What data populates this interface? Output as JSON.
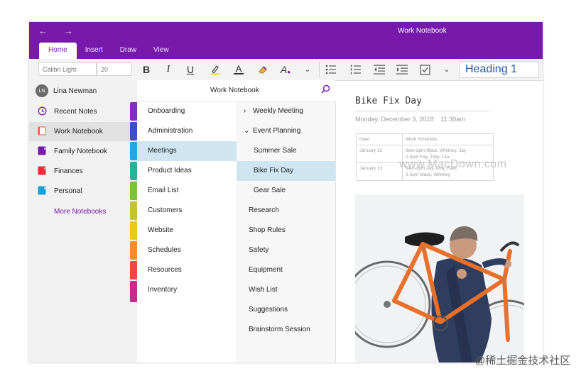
{
  "window": {
    "title": "Work Notebook",
    "back_icon": "back-arrow-icon",
    "forward_icon": "forward-arrow-icon"
  },
  "ribbon_tabs": [
    "Home",
    "Insert",
    "Draw",
    "View"
  ],
  "ribbon": {
    "font_name": "Calibri Light",
    "font_size": "20",
    "bold": "B",
    "italic": "I",
    "underline": "U",
    "font_color_glyph": "A",
    "text_style_glyph": "A",
    "style": "Heading 1"
  },
  "user": {
    "initials": "LN",
    "name": "Lina Newman"
  },
  "notebooks": [
    {
      "label": "Recent Notes",
      "icon": "clock-icon",
      "color": "#7719aa"
    },
    {
      "label": "Work Notebook",
      "icon": "notebook-icon",
      "color": "#e8603c"
    },
    {
      "label": "Family Notebook",
      "icon": "notebook-icon",
      "color": "#7719aa"
    },
    {
      "label": "Finances",
      "icon": "notebook-icon",
      "color": "#e0303b"
    },
    {
      "label": "Personal",
      "icon": "notebook-icon",
      "color": "#1aa0d8"
    }
  ],
  "more_notebooks": "More Notebooks",
  "notebook_pane_title": "Work Notebook",
  "sections": [
    {
      "label": "Onboarding",
      "color": "#8a2cb5"
    },
    {
      "label": "Administration",
      "color": "#3a52c6"
    },
    {
      "label": "Meetings",
      "color": "#2ea3d8"
    },
    {
      "label": "Product Ideas",
      "color": "#27b39a"
    },
    {
      "label": "Email List",
      "color": "#7ac043"
    },
    {
      "label": "Customers",
      "color": "#c4c330"
    },
    {
      "label": "Website",
      "color": "#f4c41e"
    },
    {
      "label": "Schedules",
      "color": "#f28f22"
    },
    {
      "label": "Resources",
      "color": "#ea4a3c"
    },
    {
      "label": "Inventory",
      "color": "#c02d8f"
    }
  ],
  "pages": [
    {
      "label": "Weekly Meeting",
      "chevron": "›"
    },
    {
      "label": "Event Planning",
      "chevron": "⌄"
    },
    {
      "label": "Summer Sale"
    },
    {
      "label": "Bike Fix Day"
    },
    {
      "label": "Gear Sale"
    },
    {
      "label": "Research"
    },
    {
      "label": "Shop Rules"
    },
    {
      "label": "Safety"
    },
    {
      "label": "Equipment"
    },
    {
      "label": "Wish List"
    },
    {
      "label": "Suggestions"
    },
    {
      "label": "Brainstorm Session"
    }
  ],
  "page": {
    "title": "Bike Fix Day",
    "date": "Monday, December 3, 2018",
    "time": "11:30am",
    "schedule": {
      "headers": [
        "Date",
        "Work Schedule"
      ],
      "rows": [
        [
          "January 12",
          "9am-2pm Mack, Whitney, Jay",
          "2-5pm Fay, Toby, Lila"
        ],
        [
          "January 13",
          "9am-2pm Jay, Amy, Raul",
          "2-5pm Mack, Whitney"
        ]
      ]
    }
  },
  "watermarks": {
    "center": "www.MacDown.com",
    "corner": "@稀土掘金技术社区"
  },
  "colors": {
    "accent": "#7719aa",
    "selection": "#cfe6f2",
    "heading": "#1d5ba8"
  }
}
